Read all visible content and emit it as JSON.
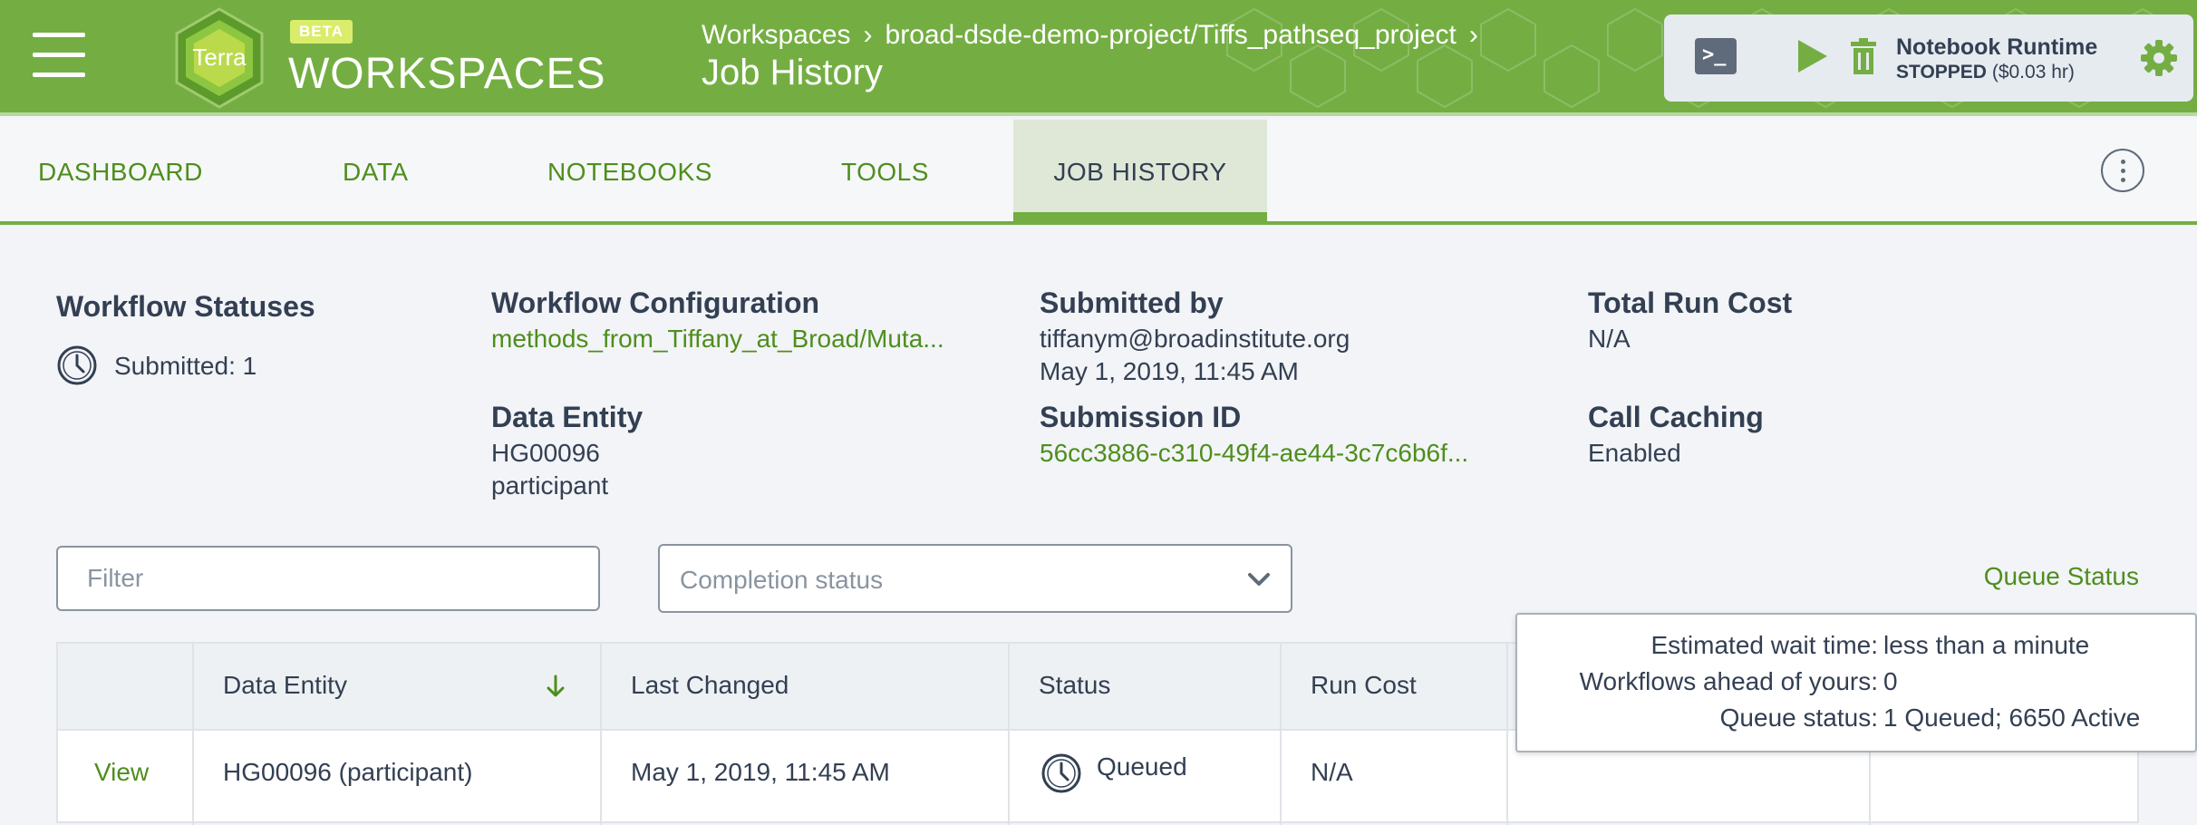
{
  "header": {
    "beta": "BETA",
    "brand": "WORKSPACES",
    "logo_text": "Terra",
    "breadcrumb": [
      "Workspaces",
      "broad-dsde-demo-project/Tiffs_pathseq_project"
    ],
    "breadcrumb_sep": "›",
    "title": "Job History"
  },
  "runtime": {
    "terminal_glyph": ">_",
    "title": "Notebook Runtime",
    "status": "STOPPED",
    "cost": "($0.03 hr)"
  },
  "tabs": [
    {
      "label": "DASHBOARD"
    },
    {
      "label": "DATA"
    },
    {
      "label": "NOTEBOOKS"
    },
    {
      "label": "TOOLS"
    },
    {
      "label": "JOB HISTORY",
      "active": true
    }
  ],
  "summary": {
    "workflow_statuses_label": "Workflow Statuses",
    "submitted": "Submitted: 1",
    "workflow_config_label": "Workflow Configuration",
    "workflow_config_value": "methods_from_Tiffany_at_Broad/Muta...",
    "data_entity_label": "Data Entity",
    "data_entity_id": "HG00096",
    "data_entity_type": "participant",
    "submitted_by_label": "Submitted by",
    "submitted_by_email": "tiffanym@broadinstitute.org",
    "submitted_by_date": "May 1, 2019, 11:45 AM",
    "submission_id_label": "Submission ID",
    "submission_id_value": "56cc3886-c310-49f4-ae44-3c7c6b6f...",
    "total_cost_label": "Total Run Cost",
    "total_cost_value": "N/A",
    "call_caching_label": "Call Caching",
    "call_caching_value": "Enabled"
  },
  "filters": {
    "filter_placeholder": "Filter",
    "completion_placeholder": "Completion status",
    "queue_status_link": "Queue Status"
  },
  "table": {
    "headers": [
      "",
      "Data Entity",
      "Last Changed",
      "Status",
      "Run Cost"
    ],
    "rows": [
      {
        "action": "View",
        "entity": "HG00096 (participant)",
        "changed": "May 1, 2019, 11:45 AM",
        "status": "Queued",
        "cost": "N/A"
      }
    ]
  },
  "tooltip": {
    "wait_label": "Estimated wait time:",
    "wait_value": "less than a minute",
    "ahead_label": "Workflows ahead of yours:",
    "ahead_value": "0",
    "queue_label": "Queue status:",
    "queue_value": "1 Queued; 6650 Active"
  },
  "colors": {
    "brand_green": "#74ae43",
    "link_green": "#4e8e1d",
    "text": "#333f52"
  }
}
